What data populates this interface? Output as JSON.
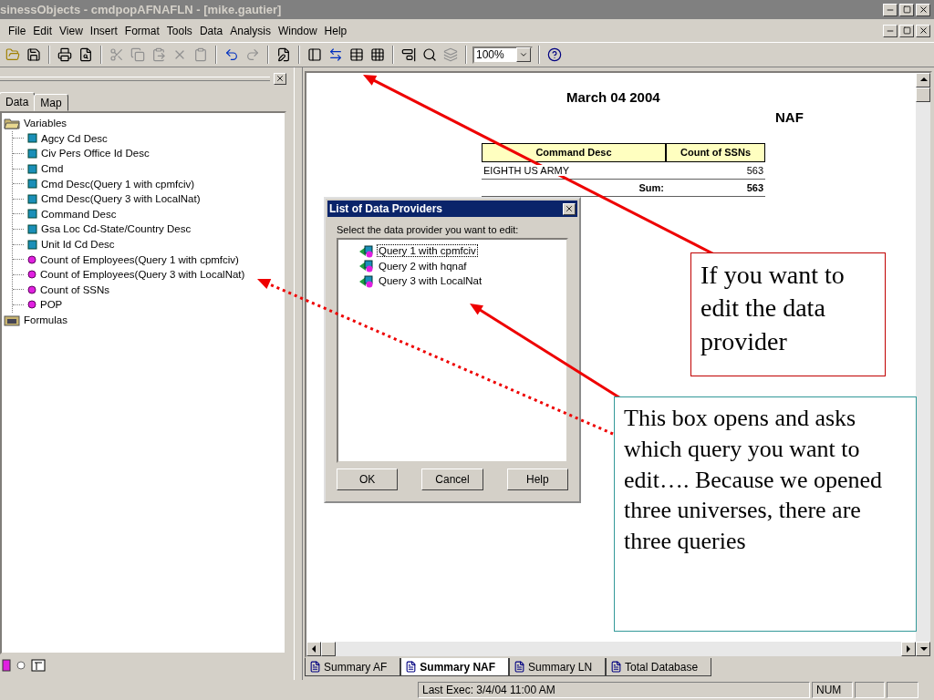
{
  "window": {
    "title": "sinessObjects - cmdpopAFNAFLN - [mike.gautier]"
  },
  "menu": [
    "File",
    "Edit",
    "View",
    "Insert",
    "Format",
    "Tools",
    "Data",
    "Analysis",
    "Window",
    "Help"
  ],
  "toolbar": {
    "zoom": "100%"
  },
  "left_panel": {
    "tabs": [
      {
        "label": "Data",
        "selected": true
      },
      {
        "label": "Map",
        "selected": false
      }
    ],
    "tree": [
      {
        "label": "Variables",
        "kind": "folder",
        "expanded": true,
        "children": [
          {
            "label": "Agcy Cd Desc",
            "kind": "dimension"
          },
          {
            "label": "Civ Pers Office Id Desc",
            "kind": "dimension"
          },
          {
            "label": "Cmd",
            "kind": "dimension"
          },
          {
            "label": "Cmd Desc(Query 1 with cpmfciv)",
            "kind": "dimension"
          },
          {
            "label": "Cmd Desc(Query 3 with LocalNat)",
            "kind": "dimension"
          },
          {
            "label": "Command Desc",
            "kind": "dimension"
          },
          {
            "label": "Gsa Loc Cd-State/Country Desc",
            "kind": "dimension"
          },
          {
            "label": "Unit Id Cd Desc",
            "kind": "dimension"
          },
          {
            "label": "Count of Employees(Query 1 with cpmfciv)",
            "kind": "measure"
          },
          {
            "label": "Count of Employees(Query 3 with LocalNat)",
            "kind": "measure"
          },
          {
            "label": "Count of SSNs",
            "kind": "measure"
          },
          {
            "label": "POP",
            "kind": "measure"
          }
        ]
      },
      {
        "label": "Formulas",
        "kind": "folder",
        "expanded": false
      }
    ]
  },
  "report": {
    "date": "March 04 2004",
    "subtitle": "NAF",
    "table": {
      "columns": [
        "Command Desc",
        "Count of SSNs"
      ],
      "rows": [
        [
          "EIGHTH US ARMY",
          "563"
        ]
      ],
      "total": {
        "label": "Sum:",
        "value": "563"
      }
    }
  },
  "dialog": {
    "title": "List of Data Providers",
    "prompt": "Select the data provider you want to edit:",
    "providers": [
      {
        "label": "Query 1 with cpmfciv",
        "selected": true
      },
      {
        "label": "Query 2 with hqnaf",
        "selected": false
      },
      {
        "label": "Query 3 with LocalNat",
        "selected": false
      }
    ],
    "buttons": [
      "OK",
      "Cancel",
      "Help"
    ]
  },
  "sheet_tabs": [
    {
      "label": "Summary AF",
      "selected": false
    },
    {
      "label": "Summary NAF",
      "selected": true
    },
    {
      "label": "Summary LN",
      "selected": false
    },
    {
      "label": "Total Database",
      "selected": false
    }
  ],
  "status_bar": {
    "last_exec": "Last Exec: 3/4/04  11:00 AM",
    "num": "NUM"
  },
  "annotations": [
    {
      "text": "If you want to edit the data provider",
      "color": "#c00000"
    },
    {
      "text": "This box opens and asks which query you want to edit…. Because we opened three universes, there are three queries",
      "color": "#339999"
    }
  ]
}
